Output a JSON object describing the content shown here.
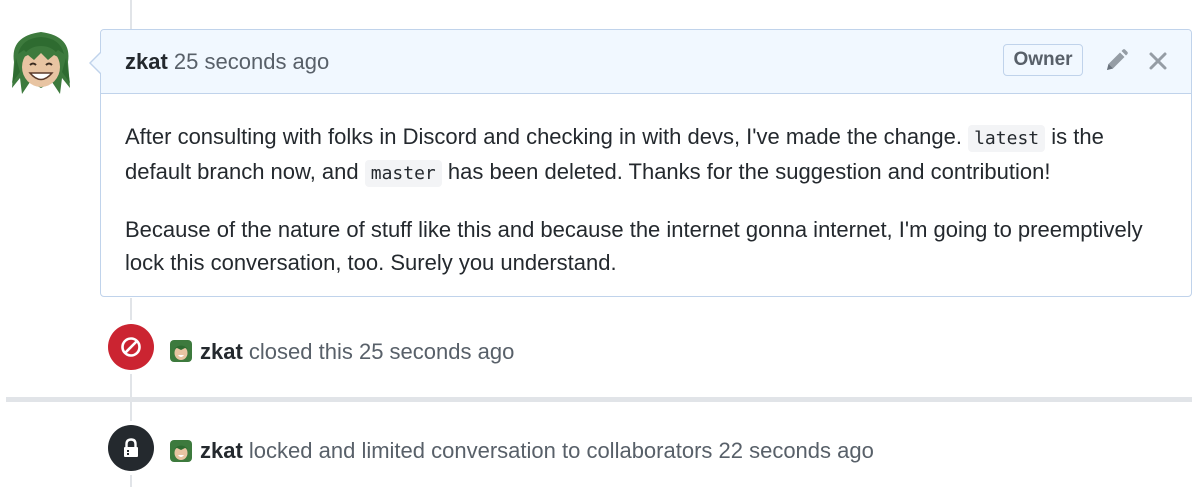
{
  "comment": {
    "author": "zkat",
    "timestamp": "25 seconds ago",
    "badge": "Owner",
    "paragraph1": {
      "before_latest": "After consulting with folks in Discord and checking in with devs, I've made the change. ",
      "code_latest": "latest",
      "after_latest": " is the default branch now, and ",
      "code_master": "master",
      "after_master": " has been deleted. Thanks for the suggestion and contribution!"
    },
    "paragraph2": "Because of the nature of stuff like this and because the internet gonna internet, I'm going to preemptively lock this conversation, too. Surely you understand."
  },
  "events": {
    "closed": {
      "actor": "zkat",
      "text": "closed this 25 seconds ago"
    },
    "locked": {
      "actor": "zkat",
      "text": "locked and limited conversation to collaborators 22 seconds ago"
    }
  },
  "icons": {
    "edit": "pencil-icon",
    "close": "x-icon",
    "closed_event": "circle-slash-icon",
    "locked_event": "lock-icon"
  },
  "colors": {
    "header_bg": "#f1f8ff",
    "border": "#c0d3eb",
    "closed_red": "#cb2431",
    "locked_dark": "#24292e"
  }
}
